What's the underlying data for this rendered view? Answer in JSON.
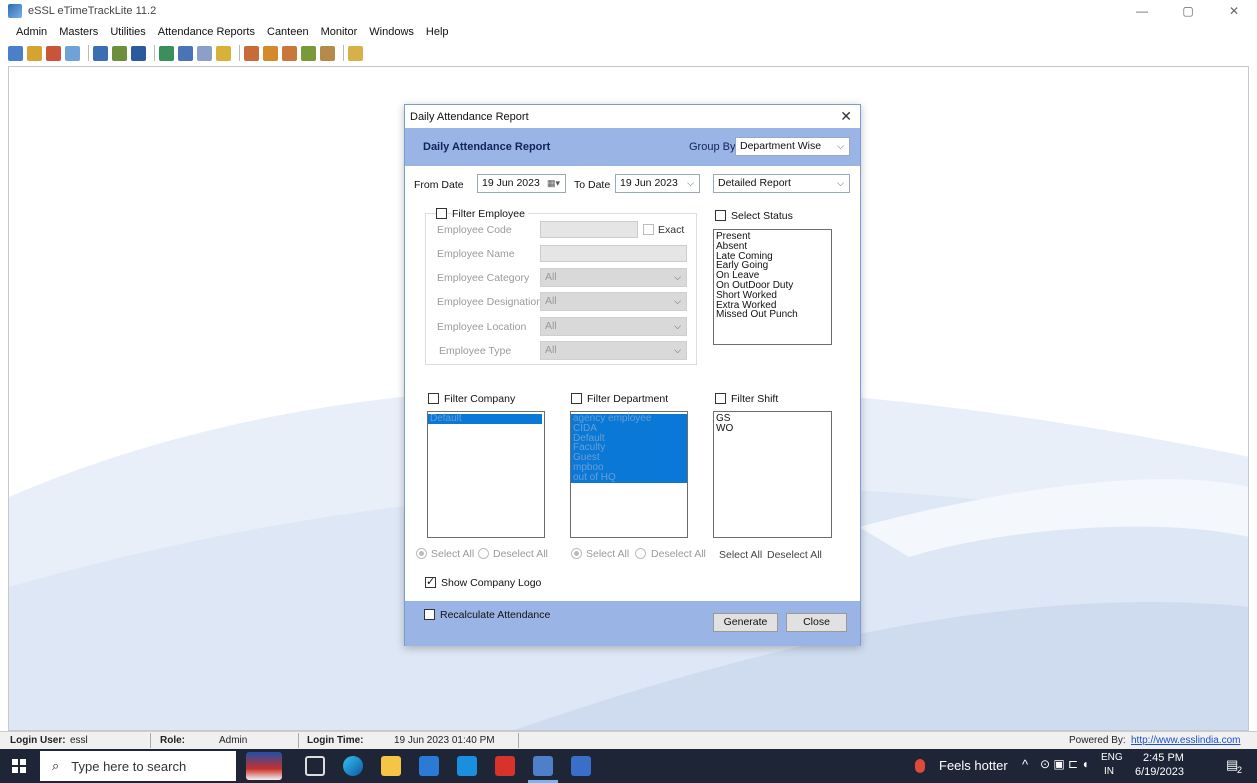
{
  "app": {
    "title": "eSSL eTimeTrackLite 11.2",
    "minimize": "—",
    "maximize": "▢",
    "close": "✕"
  },
  "menu": [
    "Admin",
    "Masters",
    "Utilities",
    "Attendance Reports",
    "Canteen",
    "Monitor",
    "Windows",
    "Help"
  ],
  "dialog": {
    "title": "Daily Attendance Report",
    "close": "✕",
    "header_title": "Daily Attendance Report",
    "group_by_label": "Group By",
    "group_by_value": "Department Wise",
    "from_date_label": "From Date",
    "from_date": "19 Jun  2023",
    "to_date_label": "To Date",
    "to_date": "19 Jun  2023",
    "report_type": "Detailed Report",
    "filter_employee": {
      "label": "Filter Employee",
      "code": "Employee Code",
      "exact": "Exact",
      "name": "Employee Name",
      "category": "Employee Category",
      "designation": "Employee Designation",
      "location": "Employee Location",
      "type": "Employee Type",
      "all": "All"
    },
    "select_status": {
      "label": "Select Status",
      "items": [
        "Present",
        "Absent",
        "Late Coming",
        "Early Going",
        "On Leave",
        "On OutDoor Duty",
        "Short Worked",
        "Extra Worked",
        "Missed Out Punch"
      ]
    },
    "filter_company": {
      "label": "Filter Company",
      "items": [
        "Default"
      ]
    },
    "filter_department": {
      "label": "Filter Department",
      "items": [
        "agency employee",
        "CIDA",
        "Default",
        "Faculty",
        "Guest",
        "mpboo",
        "out of HQ"
      ]
    },
    "filter_shift": {
      "label": "Filter Shift",
      "items": [
        "GS",
        "WO"
      ]
    },
    "select_all": "Select All",
    "deselect_all": "Deselect All",
    "show_company_logo": "Show Company Logo",
    "recalculate": "Recalculate Attendance",
    "generate": "Generate",
    "close_btn": "Close"
  },
  "status": {
    "login_user_label": "Login User:",
    "login_user": "essl",
    "role_label": "Role:",
    "role": "Admin",
    "login_time_label": "Login Time:",
    "login_time": "19 Jun 2023 01:40 PM",
    "powered_by": "Powered By:",
    "url": "http://www.esslindia.com"
  },
  "taskbar": {
    "search_placeholder": "Type here to search",
    "weather": "Feels hotter",
    "lang_1": "ENG",
    "lang_2": "IN",
    "time": "2:45 PM",
    "date": "6/19/2023",
    "notif_count": "2",
    "chevron": "^"
  }
}
